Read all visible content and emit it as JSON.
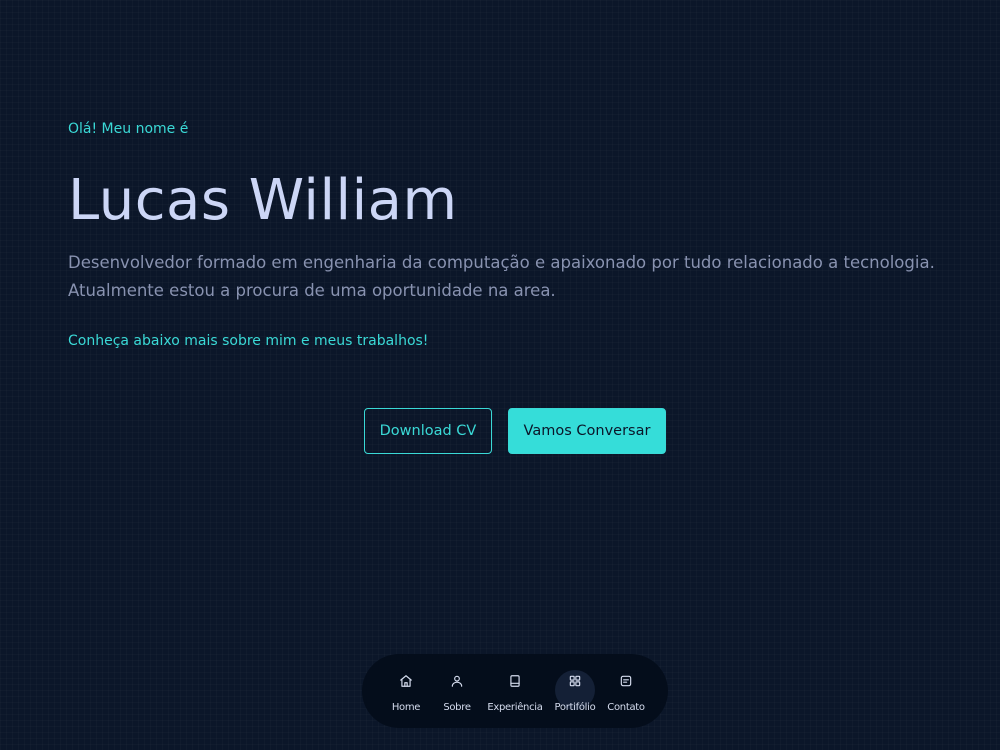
{
  "hero": {
    "greeting": "Olá! Meu nome é",
    "name": "Lucas William",
    "description_line1": "Desenvolvedor formado em engenharia da computação e apaixonado por tudo relacionado a tecnologia.",
    "description_line2": "Atualmente estou a procura de uma oportunidade na area.",
    "cta": "Conheça abaixo mais sobre mim e meus trabalhos!"
  },
  "buttons": {
    "download_cv": "Download CV",
    "vamos_conversar": "Vamos Conversar"
  },
  "nav": {
    "items": [
      {
        "label": "Home",
        "icon": "home-icon",
        "active": false
      },
      {
        "label": "Sobre",
        "icon": "user-icon",
        "active": false
      },
      {
        "label": "Experiência",
        "icon": "book-icon",
        "active": false
      },
      {
        "label": "Portifólio",
        "icon": "grid-icon",
        "active": true
      },
      {
        "label": "Contato",
        "icon": "message-icon",
        "active": false
      }
    ]
  },
  "colors": {
    "background": "#0b1629",
    "accent": "#3ad9d6",
    "heading": "#ccd6f6",
    "body_text": "#8892b0",
    "dock": "#040d1b"
  }
}
